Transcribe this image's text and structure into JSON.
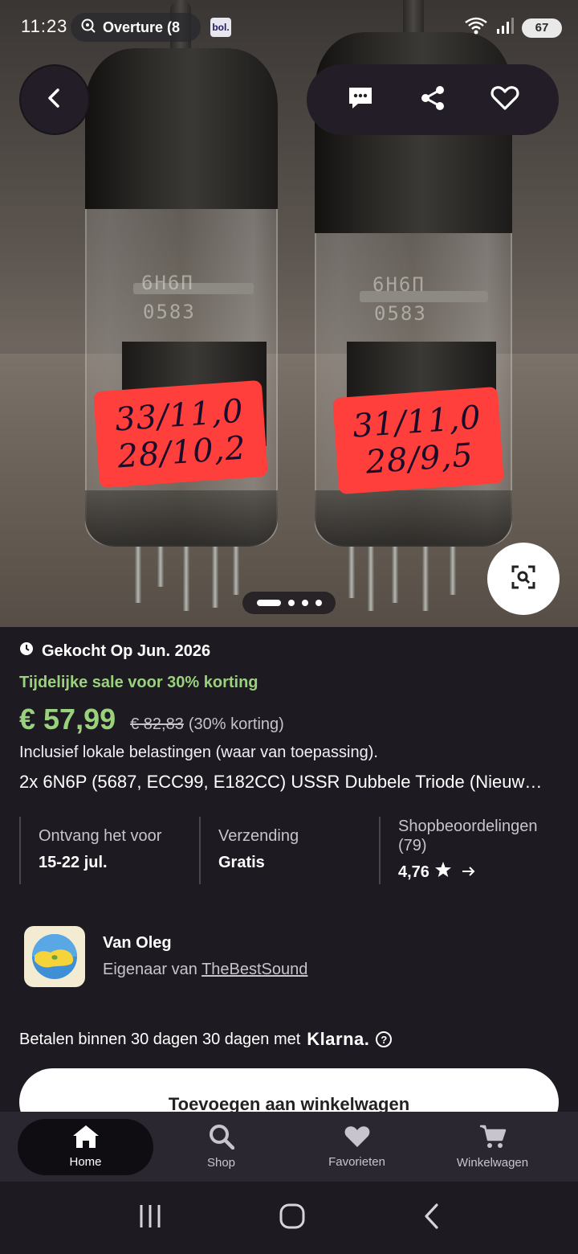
{
  "status_bar": {
    "time": "11:23",
    "notification_app": "Overture (8",
    "bol_badge": "bol.",
    "battery": "67"
  },
  "hero": {
    "image_description_icon": "product-photo",
    "tube_left": {
      "print": "6Н6П",
      "serial": "0583",
      "sticker_line1": "33/11,0",
      "sticker_line2": "28/10,2"
    },
    "tube_right": {
      "print": "6Н6П",
      "serial": "0583",
      "sticker_line1": "31/11,0",
      "sticker_line2": "28/9,5"
    },
    "pager": {
      "count": 4,
      "active_index": 0
    }
  },
  "product": {
    "purchased": "Gekocht Op Jun. 2026",
    "sale_text": "Tijdelijke sale voor 30% korting",
    "price": "€ 57,99",
    "old_price": "€ 82,83",
    "discount": "(30% korting)",
    "tax_note": "Inclusief lokale belastingen (waar van toepassing).",
    "title": "2x 6N6P (5687, ECC99, E182CC) USSR Dubbele Triode (Nieuw…"
  },
  "info": {
    "delivery_label": "Ontvang het voor",
    "delivery_value": "15-22 jul.",
    "shipping_label": "Verzending",
    "shipping_value": "Gratis",
    "reviews_label": "Shopbeoordelingen (79)",
    "reviews_value": "4,76"
  },
  "seller": {
    "name": "Van Oleg",
    "owner_prefix": "Eigenaar van",
    "shop_name": "TheBestSound"
  },
  "klarna": {
    "text": "Betalen binnen 30 dagen 30 dagen met",
    "logo": "Klarna."
  },
  "cart_button": "Toevoegen aan winkelwagen",
  "nav": {
    "home": "Home",
    "shop": "Shop",
    "favorites": "Favorieten",
    "cart": "Winkelwagen"
  },
  "colors": {
    "accent_green": "#9ad17d",
    "background": "#1d1a21",
    "nav_bg": "#2b2730"
  }
}
